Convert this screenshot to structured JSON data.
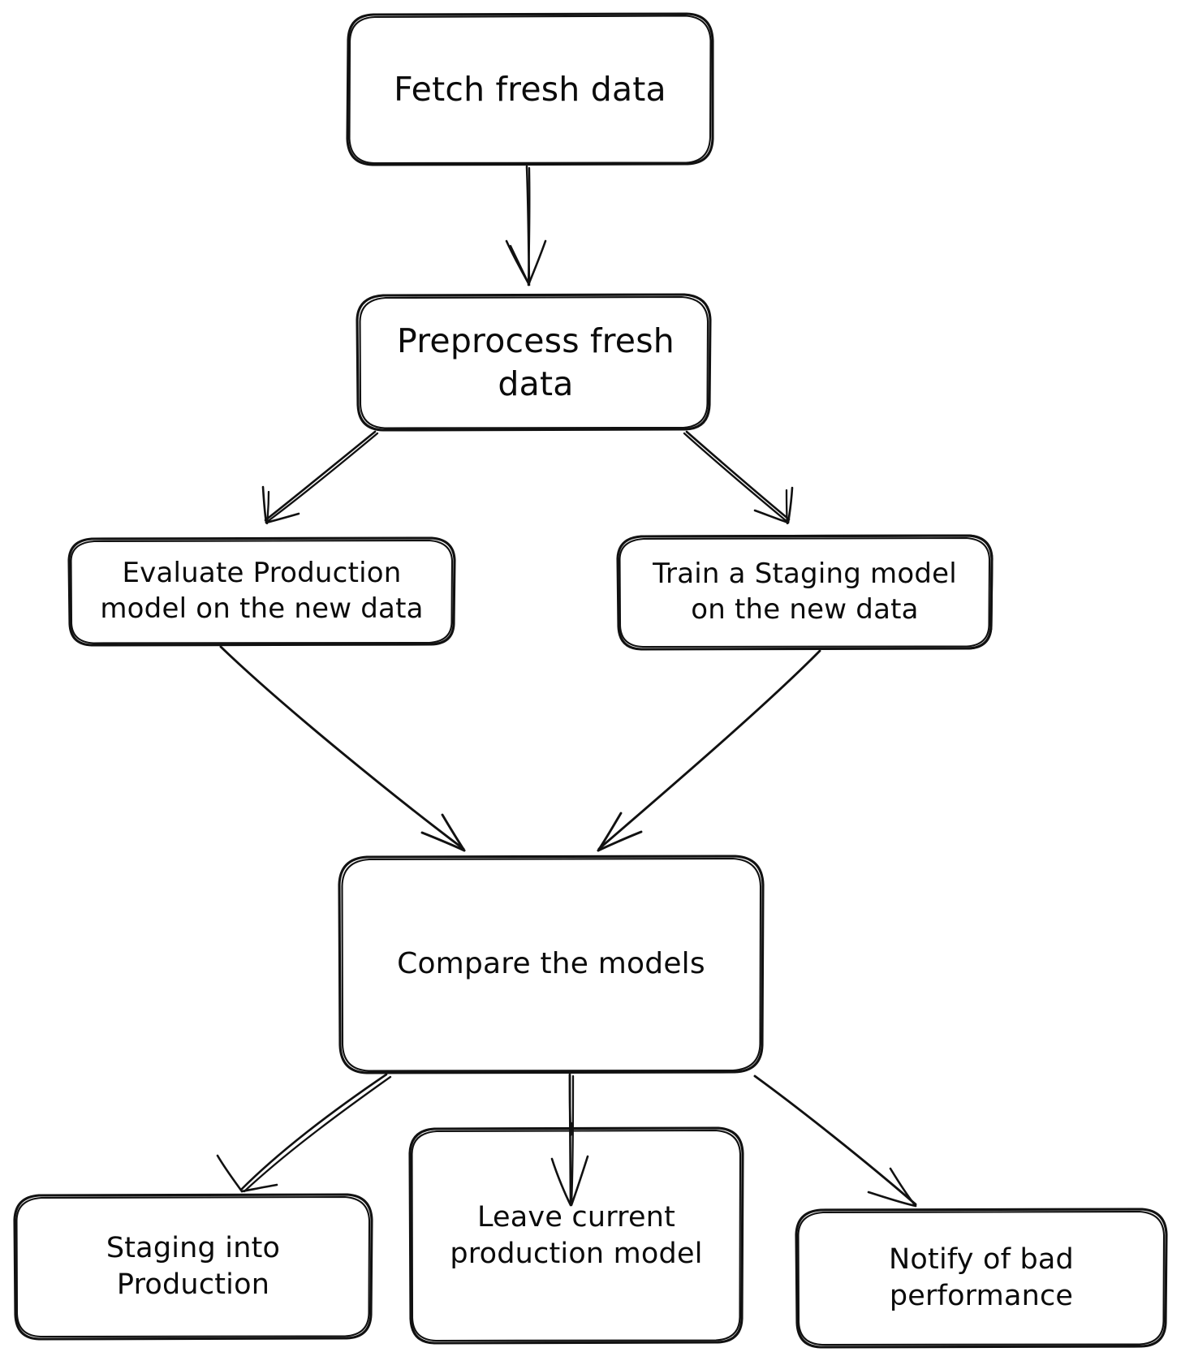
{
  "diagram": {
    "type": "flowchart",
    "orientation": "top-down",
    "background_color": "#ffffff",
    "stroke_color": "#111111",
    "text_color": "#0b0b0b",
    "style": "hand-drawn-sketch",
    "nodes": [
      {
        "id": "fetch",
        "label": "Fetch fresh data"
      },
      {
        "id": "pre",
        "label": "Preprocess fresh data"
      },
      {
        "id": "eval",
        "label": "Evaluate Production\nmodel on the new data"
      },
      {
        "id": "train",
        "label": "Train a Staging model\non the new data"
      },
      {
        "id": "compare",
        "label": "Compare the models"
      },
      {
        "id": "stage",
        "label": "Staging into\nProduction"
      },
      {
        "id": "leave",
        "label": "Leave current\nproduction model"
      },
      {
        "id": "notify",
        "label": "Notify of bad\nperformance"
      }
    ],
    "edges": [
      {
        "from": "fetch",
        "to": "pre"
      },
      {
        "from": "pre",
        "to": "eval"
      },
      {
        "from": "pre",
        "to": "train"
      },
      {
        "from": "eval",
        "to": "compare"
      },
      {
        "from": "train",
        "to": "compare"
      },
      {
        "from": "compare",
        "to": "stage"
      },
      {
        "from": "compare",
        "to": "leave"
      },
      {
        "from": "compare",
        "to": "notify"
      }
    ]
  }
}
